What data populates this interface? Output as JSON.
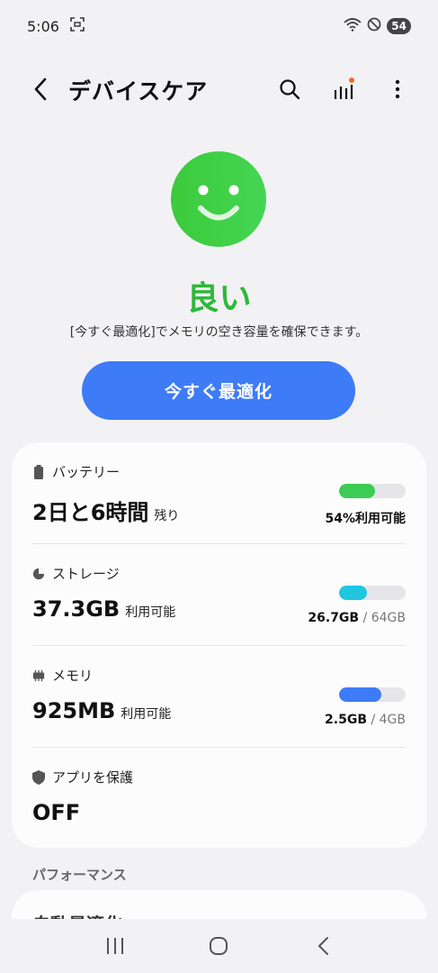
{
  "status_bar": {
    "time": "5:06",
    "battery": "54"
  },
  "app_bar": {
    "title": "デバイスケア"
  },
  "hero": {
    "status": "良い",
    "hint": "[今すぐ最適化]でメモリの空き容量を確保できます。",
    "button_label": "今すぐ最適化"
  },
  "rows": [
    {
      "label": "バッテリー",
      "value": "2日と6時間",
      "unit": "残り",
      "bar_fraction": 0.54,
      "bar_color": "#3ccb55",
      "right_strong": "54%利用可能",
      "right_muted": ""
    },
    {
      "label": "ストレージ",
      "value": "37.3GB",
      "unit": "利用可能",
      "bar_fraction": 0.42,
      "bar_color": "#1fc6e0",
      "right_strong": "26.7GB",
      "right_muted": " / 64GB"
    },
    {
      "label": "メモリ",
      "value": "925MB",
      "unit": "利用可能",
      "bar_fraction": 0.64,
      "bar_color": "#3e7bf6",
      "right_strong": "2.5GB",
      "right_muted": " / 4GB"
    },
    {
      "label": "アプリを保護",
      "value": "OFF",
      "unit": ""
    }
  ],
  "section": {
    "title": "パフォーマンス",
    "next_item": "自動最適化"
  },
  "colors": {
    "accent": "#3e7bf6",
    "good": "#2fb83a",
    "notification_dot": "#f06a2c"
  }
}
